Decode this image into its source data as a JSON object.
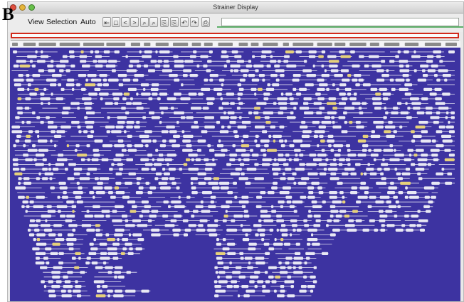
{
  "panel_label": "B",
  "window": {
    "title": "Strainer Display"
  },
  "menu": [
    "View",
    "Selection",
    "Auto"
  ],
  "toolbar": [
    {
      "name": "first-page-icon",
      "glyph": "⇤"
    },
    {
      "name": "page-icon",
      "glyph": "□"
    },
    {
      "name": "previous-icon",
      "glyph": "<"
    },
    {
      "name": "next-icon",
      "glyph": ">"
    },
    {
      "name": "zoom-in-icon",
      "glyph": "⌕"
    },
    {
      "name": "zoom-out-icon",
      "glyph": "⌕"
    },
    {
      "name": "copy-icon",
      "glyph": "⎘"
    },
    {
      "name": "paste-icon",
      "glyph": "⎘"
    },
    {
      "name": "undo-icon",
      "glyph": "↶"
    },
    {
      "name": "redo-icon",
      "glyph": "↷"
    },
    {
      "name": "print-icon",
      "glyph": "⎙"
    }
  ],
  "colors": {
    "display_background": "#3d33a1",
    "feature": "#e8e8f4",
    "track_bar": "#8a8a8a",
    "progress_border": "#d22a1c",
    "highlight": "#e6d17a"
  }
}
